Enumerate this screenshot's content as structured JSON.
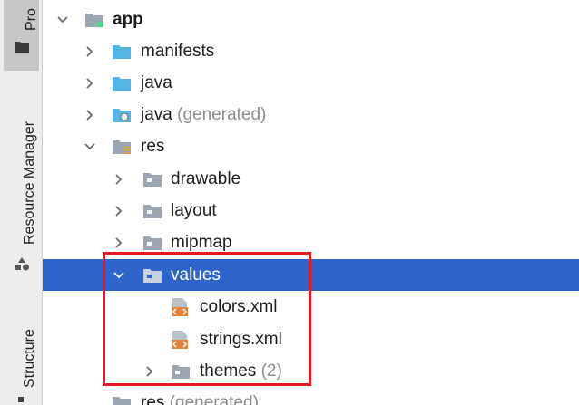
{
  "tool_strip": {
    "project_tab": "Pro",
    "resource_manager_tab": "Resource Manager",
    "structure_tab": "Structure"
  },
  "tree": {
    "rows": [
      {
        "label": "app",
        "extra": "",
        "chevron": "down",
        "icon": "module-folder-icon",
        "bold": true
      },
      {
        "label": "manifests",
        "extra": "",
        "chevron": "right",
        "icon": "folder-icon",
        "bold": false
      },
      {
        "label": "java",
        "extra": "",
        "chevron": "right",
        "icon": "folder-icon",
        "bold": false
      },
      {
        "label": "java",
        "extra": "(generated)",
        "chevron": "right",
        "icon": "generated-folder-icon",
        "bold": false
      },
      {
        "label": "res",
        "extra": "",
        "chevron": "down",
        "icon": "resource-folder-icon",
        "bold": false
      },
      {
        "label": "drawable",
        "extra": "",
        "chevron": "right",
        "icon": "folder-icon",
        "bold": false
      },
      {
        "label": "layout",
        "extra": "",
        "chevron": "right",
        "icon": "folder-icon",
        "bold": false
      },
      {
        "label": "mipmap",
        "extra": "",
        "chevron": "right",
        "icon": "folder-icon",
        "bold": false
      },
      {
        "label": "values",
        "extra": "",
        "chevron": "down",
        "icon": "folder-icon",
        "bold": false,
        "selected": true
      },
      {
        "label": "colors.xml",
        "extra": "",
        "chevron": "none",
        "icon": "xml-file-icon",
        "bold": false
      },
      {
        "label": "strings.xml",
        "extra": "",
        "chevron": "none",
        "icon": "xml-file-icon",
        "bold": false
      },
      {
        "label": "themes",
        "extra": "(2)",
        "chevron": "right",
        "icon": "folder-icon",
        "bold": false
      },
      {
        "label": "res",
        "extra": "(generated)",
        "chevron": "none",
        "icon": "folder-icon",
        "bold": false
      }
    ]
  },
  "colors": {
    "selection": "#2f65ca",
    "highlight_box": "#e21b23",
    "folder": "#55b6e6",
    "xml_badge": "#e0843e"
  }
}
